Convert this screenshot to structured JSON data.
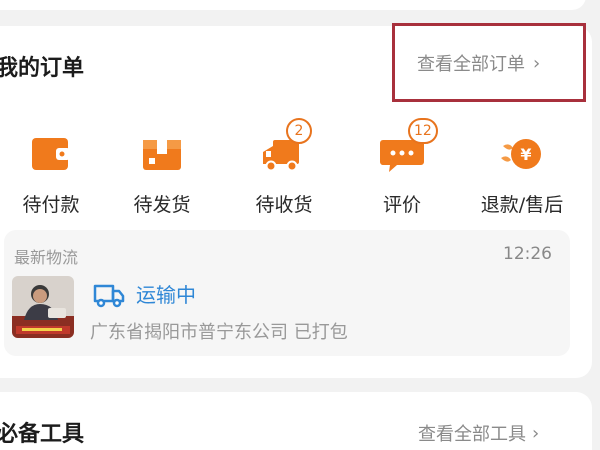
{
  "orders": {
    "title": "我的订单",
    "view_all_label": "查看全部订单",
    "statuses": [
      {
        "label": "待付款",
        "icon": "wallet-icon",
        "badge": null
      },
      {
        "label": "待发货",
        "icon": "package-icon",
        "badge": null
      },
      {
        "label": "待收货",
        "icon": "delivery-truck-icon",
        "badge": "2"
      },
      {
        "label": "评价",
        "icon": "comment-icon",
        "badge": "12"
      },
      {
        "label": "退款/售后",
        "icon": "refund-yen-icon",
        "badge": null
      }
    ],
    "logistics": {
      "label": "最新物流",
      "time": "12:26",
      "status": "运输中",
      "address": "广东省揭阳市普宁东公司 已打包"
    }
  },
  "tools": {
    "title": "必备工具",
    "view_all_label": "查看全部工具"
  },
  "colors": {
    "accent_orange": "#f07a1c",
    "status_blue": "#2f87d6",
    "highlight_border": "#a8303c"
  }
}
